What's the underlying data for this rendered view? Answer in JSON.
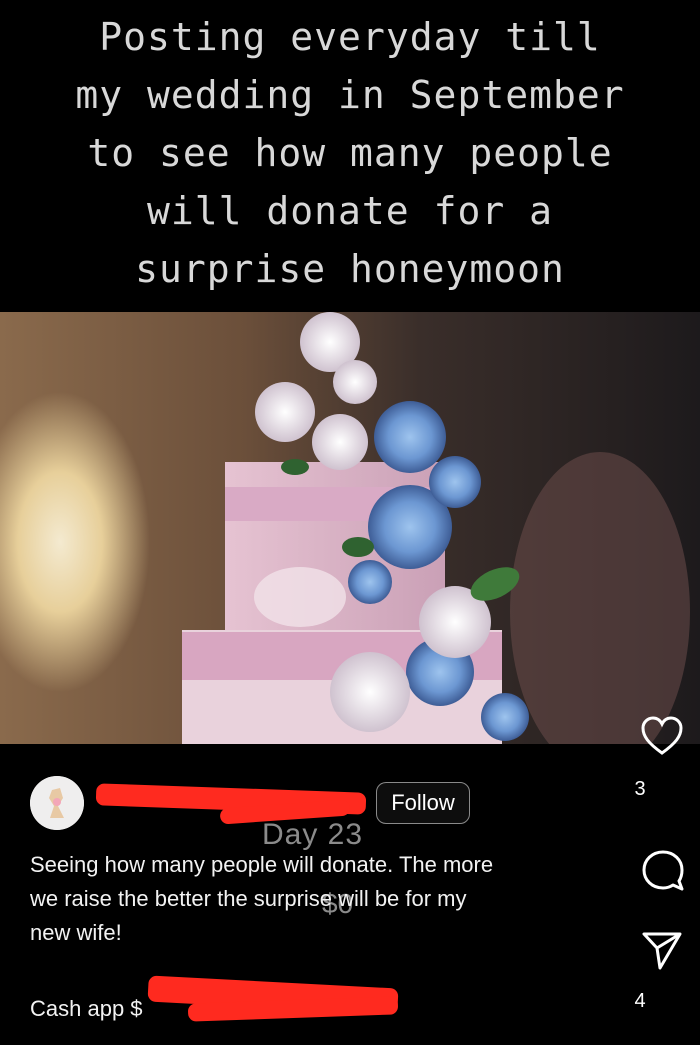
{
  "headline": {
    "line1": "Posting everyday till",
    "line2": "my wedding in September",
    "line3": "to see how many people",
    "line4": "will donate for a",
    "line5": "surprise honeymoon"
  },
  "photo": {
    "subject": "wedding-cake-with-flowers"
  },
  "actions": {
    "like_count": "3",
    "share_count": "4"
  },
  "author": {
    "follow_label": "Follow",
    "name_visible_fragment": "..."
  },
  "overlay": {
    "day_label": "Day 23",
    "amount_label": "$0"
  },
  "caption": {
    "text_line1": "Seeing how many people will donate. The more",
    "text_line2": "we raise the better the surprise will be for my",
    "text_line3": "new wife!",
    "cashapp_label": "Cash app $"
  },
  "colors": {
    "redaction": "#ff2a1f",
    "background": "#000000",
    "overlay_text": "#8b8b8b"
  }
}
